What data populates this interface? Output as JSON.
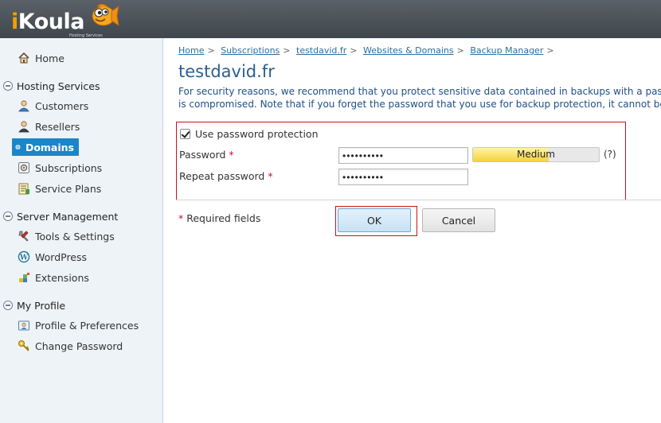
{
  "brand": {
    "logo_text_i": "i",
    "logo_text_rest": "Koula",
    "tagline": "Hosting Services"
  },
  "sidebar": {
    "home": "Home",
    "groups": [
      {
        "label": "Hosting Services",
        "items": [
          "Customers",
          "Resellers",
          "Domains",
          "Subscriptions",
          "Service Plans"
        ]
      },
      {
        "label": "Server Management",
        "items": [
          "Tools & Settings",
          "WordPress",
          "Extensions"
        ]
      },
      {
        "label": "My Profile",
        "items": [
          "Profile & Preferences",
          "Change Password"
        ]
      }
    ],
    "active_item": "Domains"
  },
  "breadcrumb": [
    "Home",
    "Subscriptions",
    "testdavid.fr",
    "Websites & Domains",
    "Backup Manager"
  ],
  "breadcrumb_sep": ">",
  "page": {
    "title": "testdavid.fr",
    "intro_line1": "For security reasons, we recommend that you protect sensitive data contained in backups with a passwo",
    "intro_line2": "is compromised. Note that if you forget the password that you use for backup protection, it cannot be r"
  },
  "form": {
    "use_protection_label": "Use password protection",
    "use_protection_checked": true,
    "password_label": "Password",
    "password_value": "••••••••••",
    "repeat_label": "Repeat password",
    "repeat_value": "••••••••••",
    "required_marker": "*",
    "strength_label": "Medium",
    "strength_level": 0.6,
    "help_label": "(?)",
    "required_note": "Required fields"
  },
  "buttons": {
    "ok": "OK",
    "cancel": "Cancel"
  },
  "colors": {
    "header": "#4a5157",
    "active_nav": "#1a86c8",
    "title": "#2b5f8e",
    "highlight_border": "#c8101e"
  }
}
